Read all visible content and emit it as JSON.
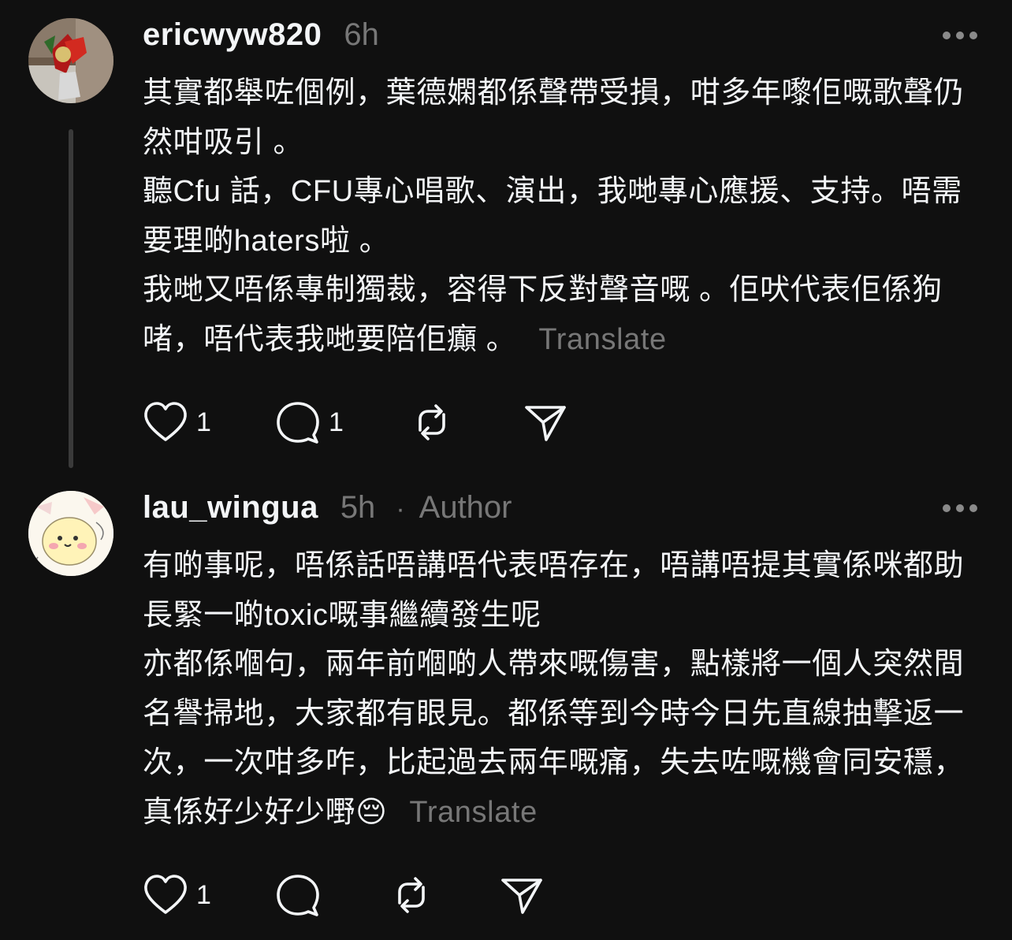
{
  "posts": [
    {
      "username": "ericwyw820",
      "time": "6h",
      "body": [
        "其實都舉咗個例，葉德嫻都係聲帶受損，咁多年嚟佢嘅歌聲仍然咁吸引 。",
        "聽Cfu 話，CFU專心唱歌、演出，我哋專心應援、支持。唔需要理啲haters啦 。",
        "我哋又唔係專制獨裁，容得下反對聲音嘅 。佢吠代表佢係狗啫，唔代表我哋要陪佢癲 。"
      ],
      "translate": "Translate",
      "actions": {
        "likes": "1",
        "replies": "1"
      }
    },
    {
      "username": "lau_wingua",
      "time": "5h",
      "separator": "·",
      "badge": "Author",
      "body": [
        "有啲事呢，唔係話唔講唔代表唔存在，唔講唔提其實係咪都助長緊一啲toxic嘅事繼續發生呢",
        "亦都係嗰句，兩年前嗰啲人帶來嘅傷害，點樣將一個人突然間名譽掃地，大家都有眼見。都係等到今時今日先直線抽擊返一次，一次咁多咋，比起過去兩年嘅痛，失去咗嘅機會同安穩，真係好少好少嘢😔"
      ],
      "translate": "Translate",
      "actions": {
        "likes": "1",
        "replies": ""
      }
    }
  ],
  "icons": [
    "heart-icon",
    "comment-icon",
    "repost-icon",
    "share-icon",
    "more-icon"
  ],
  "colors": {
    "background": "#101010",
    "text": "#f3f5f7",
    "muted": "#777777"
  }
}
